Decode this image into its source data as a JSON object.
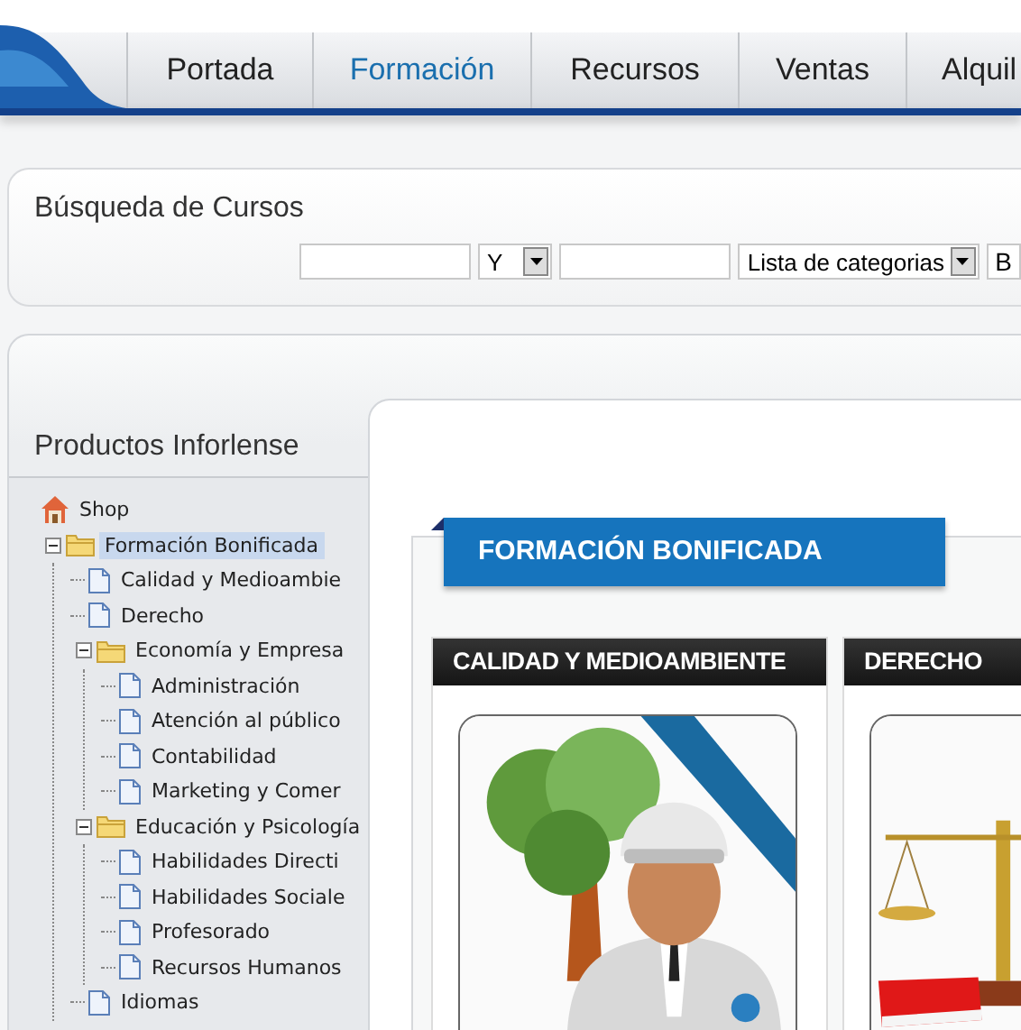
{
  "nav": [
    {
      "label": "Portada",
      "selected": false
    },
    {
      "label": "Formación",
      "selected": true
    },
    {
      "label": "Recursos",
      "selected": false
    },
    {
      "label": "Ventas",
      "selected": false
    },
    {
      "label": "Alquil",
      "selected": false
    }
  ],
  "search": {
    "title": "Búsqueda de Cursos",
    "fields": [
      {
        "kind": "text"
      },
      {
        "kind": "select",
        "value": "Y"
      },
      {
        "kind": "text"
      },
      {
        "kind": "select",
        "value": "Lista de categorias"
      },
      {
        "kind": "button",
        "label": "B"
      }
    ]
  },
  "sidebar": {
    "title": "Productos Inforlense",
    "tree": [
      {
        "label": "Shop",
        "kind": "home",
        "selected": false
      },
      {
        "label": "Formación Bonificada",
        "kind": "folder",
        "expanded": true,
        "selected": true,
        "children": [
          {
            "label": "Calidad y Medioambie",
            "kind": "page",
            "selected": false
          },
          {
            "label": "Derecho",
            "kind": "page",
            "selected": false
          },
          {
            "label": "Economía y Empresa",
            "kind": "folder",
            "expanded": true,
            "selected": false,
            "children": [
              {
                "label": "Administración",
                "kind": "page",
                "selected": false
              },
              {
                "label": "Atención al público",
                "kind": "page",
                "selected": false
              },
              {
                "label": "Contabilidad",
                "kind": "page",
                "selected": false
              },
              {
                "label": "Marketing y Comer",
                "kind": "page",
                "selected": false
              }
            ]
          },
          {
            "label": "Educación y Psicología",
            "kind": "folder",
            "expanded": true,
            "selected": false,
            "children": [
              {
                "label": "Habilidades Directi",
                "kind": "page",
                "selected": false
              },
              {
                "label": "Habilidades Sociale",
                "kind": "page",
                "selected": false
              },
              {
                "label": "Profesorado",
                "kind": "page",
                "selected": false
              },
              {
                "label": "Recursos Humanos",
                "kind": "page",
                "selected": false
              }
            ]
          },
          {
            "label": "Idiomas",
            "kind": "page",
            "selected": false
          }
        ]
      }
    ]
  },
  "content": {
    "banner": "FORMACIÓN BONIFICADA",
    "cards": [
      {
        "title": "CALIDAD Y MEDIOAMBIENTE",
        "kind": "picture"
      },
      {
        "title": "DERECHO",
        "kind": "picture"
      }
    ]
  }
}
